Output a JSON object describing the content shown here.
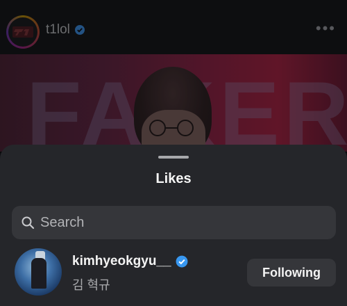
{
  "post": {
    "account_name": "t1lol",
    "more_glyph": "•••",
    "image_text": "FAKER"
  },
  "likes_sheet": {
    "title": "Likes",
    "search": {
      "placeholder": "Search",
      "icon": "search-icon"
    },
    "users": [
      {
        "username": "kimhyeokgyu__",
        "full_name": "김 혁규",
        "verified": true,
        "button_label": "Following"
      }
    ]
  },
  "colors": {
    "verified_blue": "#3897f0",
    "sheet_bg": "#25262a",
    "field_bg": "#35363a"
  }
}
